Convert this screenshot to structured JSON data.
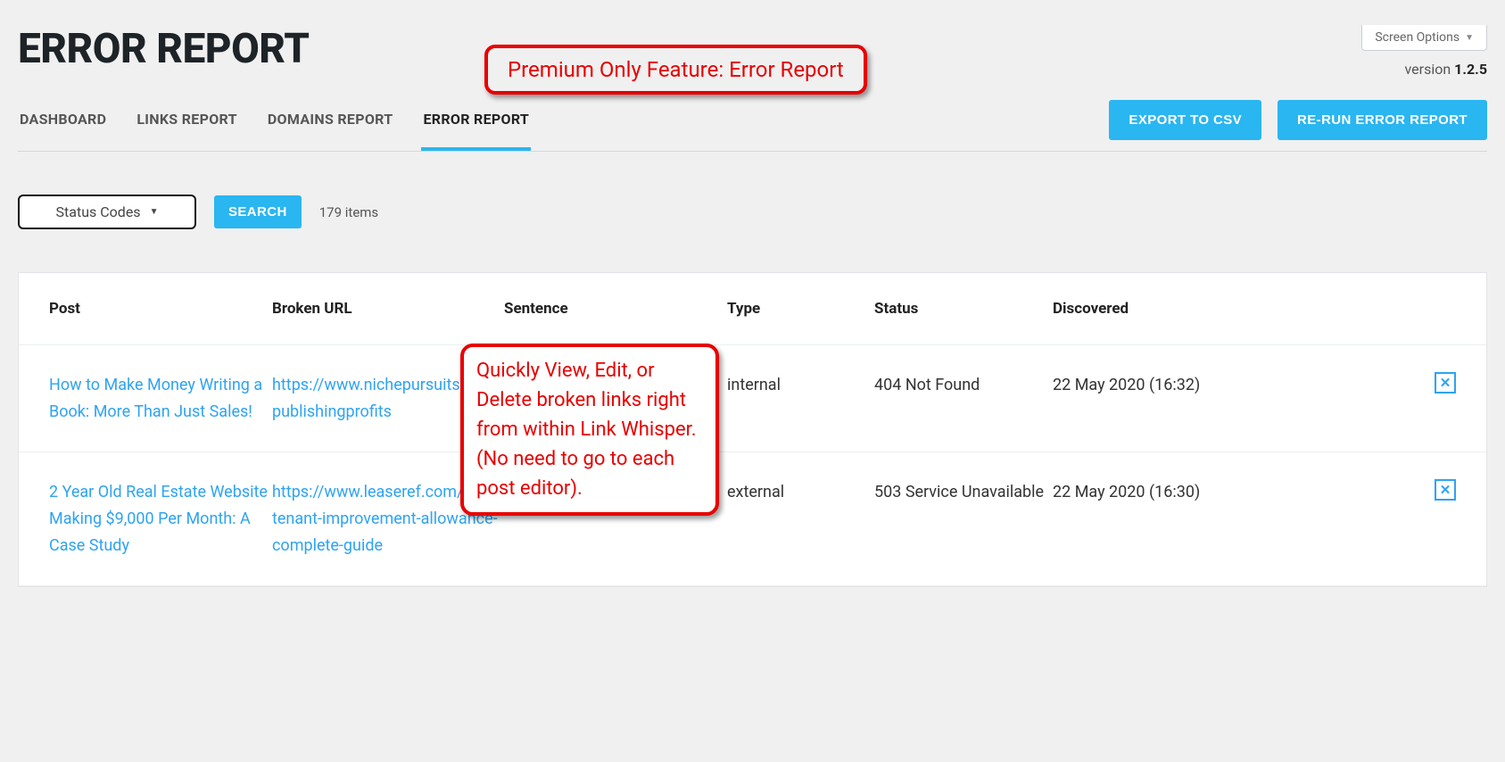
{
  "screen_options_label": "Screen Options",
  "version_label": "version ",
  "version_number": "1.2.5",
  "page_title": "ERROR REPORT",
  "annotation_top": "Premium Only Feature: Error Report",
  "annotation_mid": "Quickly View, Edit, or Delete broken links right from within Link Whisper. (No need to go to each post editor).",
  "tabs": {
    "dashboard": "DASHBOARD",
    "links_report": "LINKS REPORT",
    "domains_report": "DOMAINS REPORT",
    "error_report": "ERROR REPORT"
  },
  "buttons": {
    "export_csv": "EXPORT TO CSV",
    "rerun": "RE-RUN ERROR REPORT",
    "search": "SEARCH"
  },
  "filter": {
    "status_codes_label": "Status Codes",
    "items_count": "179 items"
  },
  "table": {
    "headers": {
      "post": "Post",
      "broken_url": "Broken URL",
      "sentence": "Sentence",
      "type": "Type",
      "status": "Status",
      "discovered": "Discovered"
    },
    "rows": [
      {
        "post": "How to Make Money Writing a Book: More Than Just Sales!",
        "broken_url": "https://www.nichepursuits.com/publishingprofits",
        "sentence": "",
        "type": "internal",
        "status": "404 Not Found",
        "discovered": "22 May 2020 (16:32)"
      },
      {
        "post": "2 Year Old Real Estate Website Making $9,000 Per Month: A Case Study",
        "broken_url": "https://www.leaseref.com/blog/tenant-improvement-allowance-complete-guide",
        "sentence": "",
        "type": "external",
        "status": "503 Service Unavailable",
        "discovered": "22 May 2020 (16:30)"
      }
    ]
  },
  "icons": {
    "close_glyph": "✕",
    "triangle_down": "▼"
  }
}
